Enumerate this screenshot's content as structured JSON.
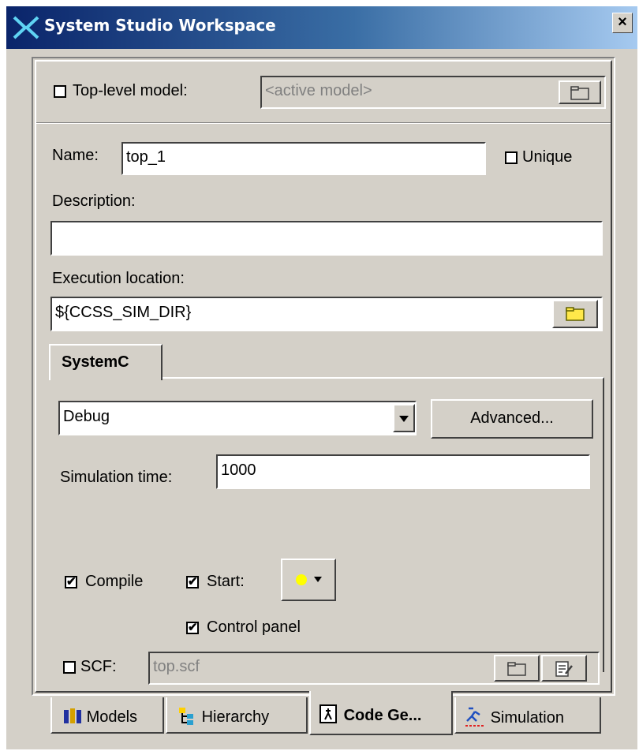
{
  "window": {
    "title": "System Studio Workspace",
    "close_label": "×"
  },
  "top_model": {
    "label": "Top-level model:",
    "checked": false,
    "placeholder": "<active model>"
  },
  "name": {
    "label": "Name:",
    "value": "top_1"
  },
  "unique": {
    "label": "Unique",
    "checked": false
  },
  "description": {
    "label": "Description:",
    "value": ""
  },
  "exec_location": {
    "label": "Execution location:",
    "value": "${CCSS_SIM_DIR}"
  },
  "tabs_inner": {
    "active": "SystemC"
  },
  "build": {
    "selected": "Debug",
    "advanced_label": "Advanced..."
  },
  "sim_time": {
    "label": "Simulation time:",
    "value": "1000"
  },
  "compile": {
    "label": "Compile",
    "checked": true
  },
  "start": {
    "label": "Start:",
    "checked": true,
    "indicator_color": "#ffff00"
  },
  "control_panel": {
    "label": "Control panel",
    "checked": true
  },
  "scf": {
    "label": "SCF:",
    "checked": false,
    "value": "top.scf"
  },
  "bottom_tabs": [
    {
      "label": "Models",
      "icon": "models-icon"
    },
    {
      "label": "Hierarchy",
      "icon": "hierarchy-icon"
    },
    {
      "label": "Code Ge...",
      "icon": "code-gen-icon",
      "active": true
    },
    {
      "label": "Simulation",
      "icon": "simulation-icon"
    }
  ]
}
